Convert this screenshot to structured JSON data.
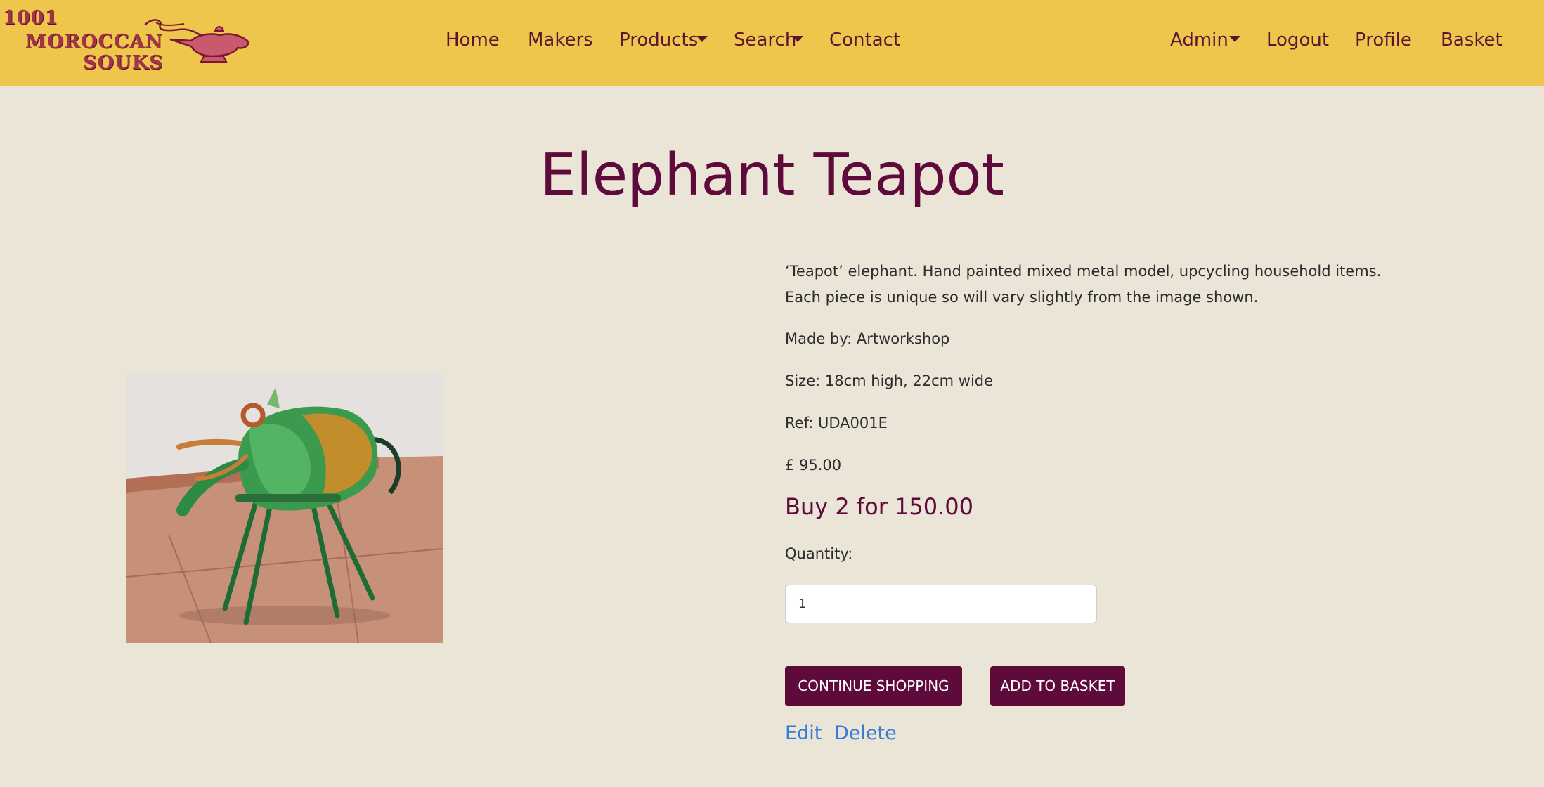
{
  "logo": {
    "line1": "1001",
    "line2": "MOROCCAN",
    "line3": "SOUKS",
    "icon": "magic-lamp-icon"
  },
  "nav": {
    "home": "Home",
    "makers": "Makers",
    "products": "Products",
    "search": "Search",
    "contact": "Contact",
    "admin": "Admin",
    "logout": "Logout",
    "profile": "Profile",
    "basket": "Basket"
  },
  "product": {
    "title": "Elephant Teapot",
    "description": "‘Teapot’ elephant. Hand painted mixed metal model, upcycling household items. Each piece is unique so will vary slightly from the image shown.",
    "maker": "Made by: Artworkshop",
    "size": "Size: 18cm high, 22cm wide",
    "ref": "Ref: UDA001E",
    "price": "£ 95.00",
    "offer": "Buy 2 for 150.00",
    "quantity_label": "Quantity:",
    "quantity_value": "1"
  },
  "actions": {
    "continue": "CONTINUE SHOPPING",
    "add": "ADD TO BASKET",
    "edit": "Edit",
    "delete": "Delete"
  },
  "colors": {
    "navbar": "#eec64c",
    "page_bg": "#ebe5d8",
    "brand": "#5e0a3a",
    "link": "#3a7bd5"
  }
}
